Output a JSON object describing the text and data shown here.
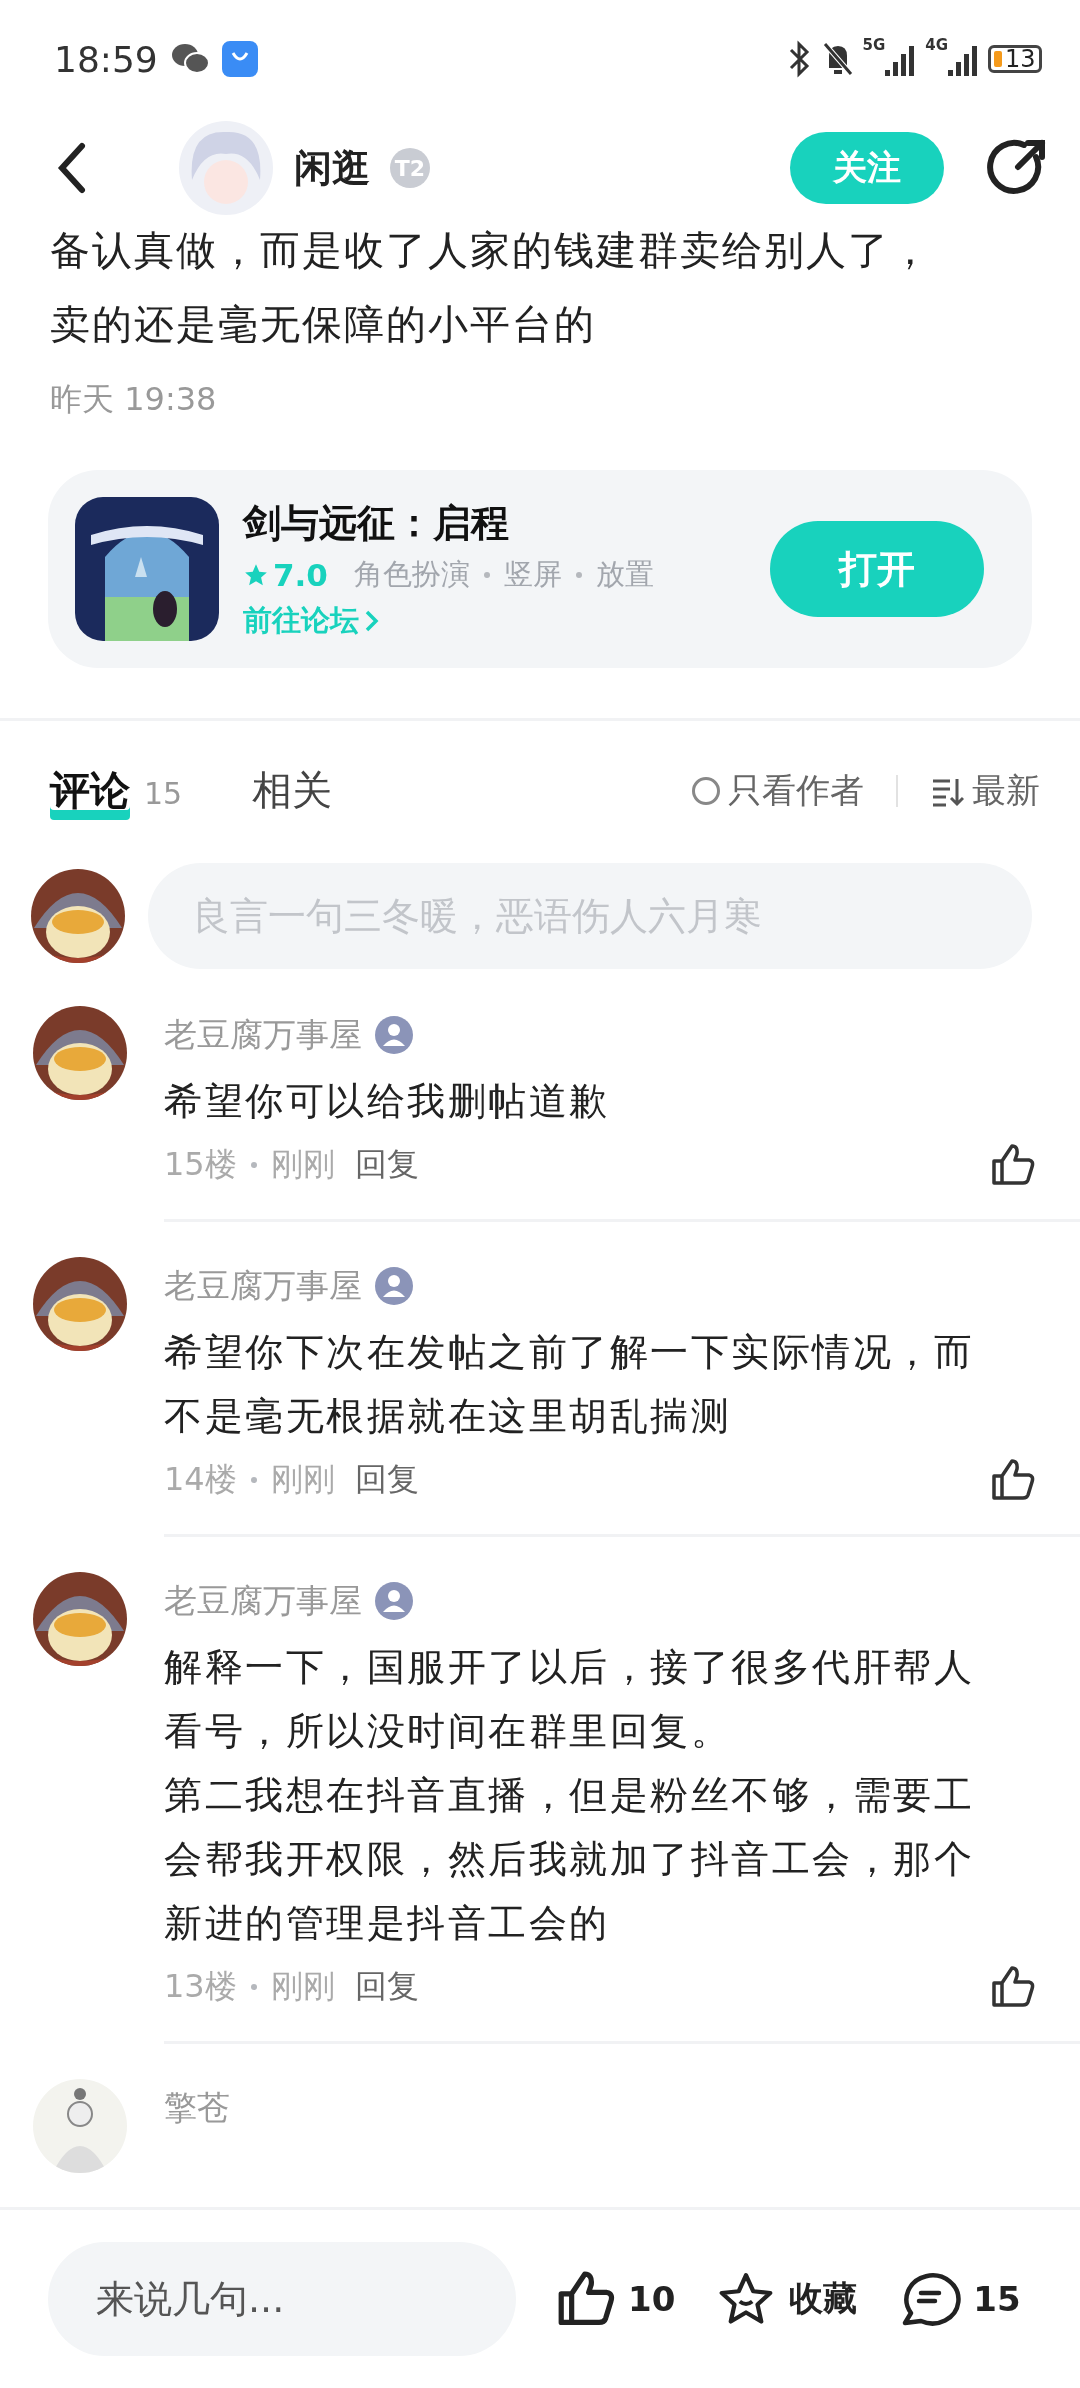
{
  "status_bar": {
    "time": "18:59",
    "networks": [
      "5G",
      "4G"
    ],
    "battery": "13"
  },
  "header": {
    "author": "闲逛",
    "author_badge": "T2",
    "follow_button": "关注"
  },
  "post": {
    "cut_line": "备认真做，而是收了人家的钱建群卖给别人了，",
    "last_line": "卖的还是毫无保障的小平台的",
    "time": "昨天 19:38"
  },
  "game_card": {
    "title": "剑与远征：启程",
    "rating": "7.0",
    "tags": [
      "角色扮演",
      "竖屏",
      "放置"
    ],
    "forum_link": "前往论坛",
    "open_button": "打开"
  },
  "tabs": [
    {
      "label": "评论",
      "count": "15",
      "selected": true
    },
    {
      "label": "相关",
      "selected": false
    }
  ],
  "filters": {
    "author_only": {
      "label": "只看作者",
      "checked": false
    },
    "sort": "最新"
  },
  "comment_input": {
    "placeholder": "良言一句三冬暖，恶语伤人六月寒"
  },
  "comments": [
    {
      "user": "老豆腐万事屋",
      "paragraphs": [
        "希望你可以给我删帖道歉"
      ],
      "floor": "15楼",
      "time": "刚刚",
      "reply": "回复"
    },
    {
      "user": "老豆腐万事屋",
      "paragraphs": [
        "希望你下次在发帖之前了解一下实际情况，而不是毫无根据就在这里胡乱揣测"
      ],
      "floor": "14楼",
      "time": "刚刚",
      "reply": "回复"
    },
    {
      "user": "老豆腐万事屋",
      "paragraphs": [
        "解释一下，国服开了以后，接了很多代肝帮人看号，所以没时间在群里回复。",
        "第二我想在抖音直播，但是粉丝不够，需要工会帮我开权限，然后我就加了抖音工会，那个新进的管理是抖音工会的"
      ],
      "floor": "13楼",
      "time": "刚刚",
      "reply": "回复"
    },
    {
      "user": "擎苍"
    }
  ],
  "bottom_bar": {
    "placeholder": "来说几句...",
    "likes": "10",
    "favorite": "收藏",
    "comments": "15"
  }
}
